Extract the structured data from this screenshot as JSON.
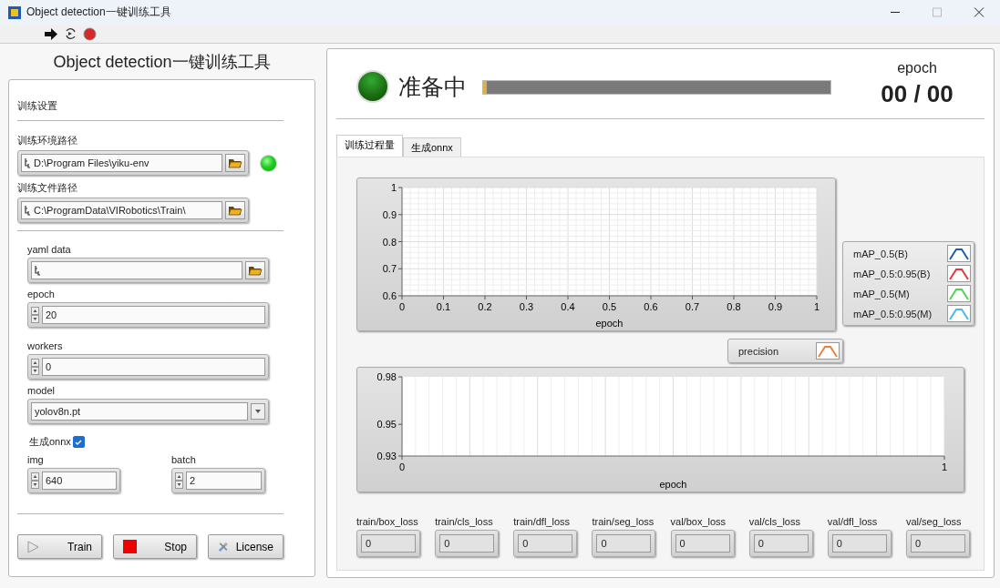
{
  "window": {
    "title": "Object detection一键训练工具"
  },
  "app_title": "Object detection一键训练工具",
  "settings": {
    "section_label": "训练设置",
    "env_path": {
      "label": "训练环境路径",
      "value": "D:\\Program Files\\yiku-env",
      "indicator_on": true
    },
    "file_path": {
      "label": "训练文件路径",
      "value": "C:\\ProgramData\\VIRobotics\\Train\\"
    },
    "yaml_data": {
      "label": "yaml data"
    },
    "epoch": {
      "label": "epoch",
      "value": "20"
    },
    "workers": {
      "label": "workers",
      "value": "0"
    },
    "model": {
      "label": "model",
      "value": "yolov8n.pt"
    },
    "export_onnx": {
      "label": "生成onnx",
      "checked": true
    },
    "img": {
      "label": "img",
      "value": "640"
    },
    "batch": {
      "label": "batch",
      "value": "2"
    }
  },
  "buttons": [
    {
      "label": "Train",
      "kind": "play"
    },
    {
      "label": "Stop",
      "kind": "stop"
    },
    {
      "label": "License",
      "kind": "tools"
    }
  ],
  "status": {
    "on": true,
    "text": "准备中",
    "progress": {
      "level": 0.01
    },
    "epoch_label": "epoch",
    "epoch_value": "00 / 00"
  },
  "tabs": [
    {
      "label": "训练过程量",
      "selected": true
    },
    {
      "label": "生成onnx",
      "selected": false
    }
  ],
  "charts": [
    {
      "chart_data": {
        "type": "line",
        "xlabel": "epoch",
        "categories": [
          "0",
          "0.1",
          "0.2",
          "0.3",
          "0.4",
          "0.5",
          "0.6",
          "0.7",
          "0.8",
          "0.9",
          "1"
        ],
        "ylim": [
          0.6,
          1
        ],
        "yticks": [
          0.6,
          0.7,
          0.8,
          0.9,
          1
        ],
        "grid": true,
        "series": [
          {
            "name": "mAP_0.5(B)",
            "color": "#1f5fa8",
            "values": [
              null,
              null,
              null,
              null,
              null,
              null,
              null,
              null,
              null,
              null,
              null
            ]
          },
          {
            "name": "mAP_0.5:0.95(B)",
            "color": "#e8343c",
            "values": [
              null,
              null,
              null,
              null,
              null,
              null,
              null,
              null,
              null,
              null,
              null
            ]
          },
          {
            "name": "mAP_0.5(M)",
            "color": "#4cd44c",
            "values": [
              null,
              null,
              null,
              null,
              null,
              null,
              null,
              null,
              null,
              null,
              null
            ]
          },
          {
            "name": "mAP_0.5:0.95(M)",
            "color": "#48b8f0",
            "values": [
              null,
              null,
              null,
              null,
              null,
              null,
              null,
              null,
              null,
              null,
              null
            ]
          }
        ]
      }
    },
    {
      "chart_data": {
        "type": "line",
        "xlabel": "epoch",
        "categories": [
          "0",
          "1"
        ],
        "ylim": [
          0.93,
          0.98
        ],
        "yticks": [
          0.93,
          0.95,
          0.98
        ],
        "grid": true,
        "series": [
          {
            "name": "precision",
            "color": "#f07f3c",
            "values": [
              null,
              null
            ]
          }
        ]
      }
    }
  ],
  "losses": [
    {
      "label": "train/box_loss",
      "value": "0"
    },
    {
      "label": "train/cls_loss",
      "value": "0"
    },
    {
      "label": "train/dfl_loss",
      "value": "0"
    },
    {
      "label": "train/seg_loss",
      "value": "0"
    },
    {
      "label": "val/box_loss",
      "value": "0"
    },
    {
      "label": "val/cls_loss",
      "value": "0"
    },
    {
      "label": "val/dfl_loss",
      "value": "0"
    },
    {
      "label": "val/seg_loss",
      "value": "0"
    }
  ]
}
